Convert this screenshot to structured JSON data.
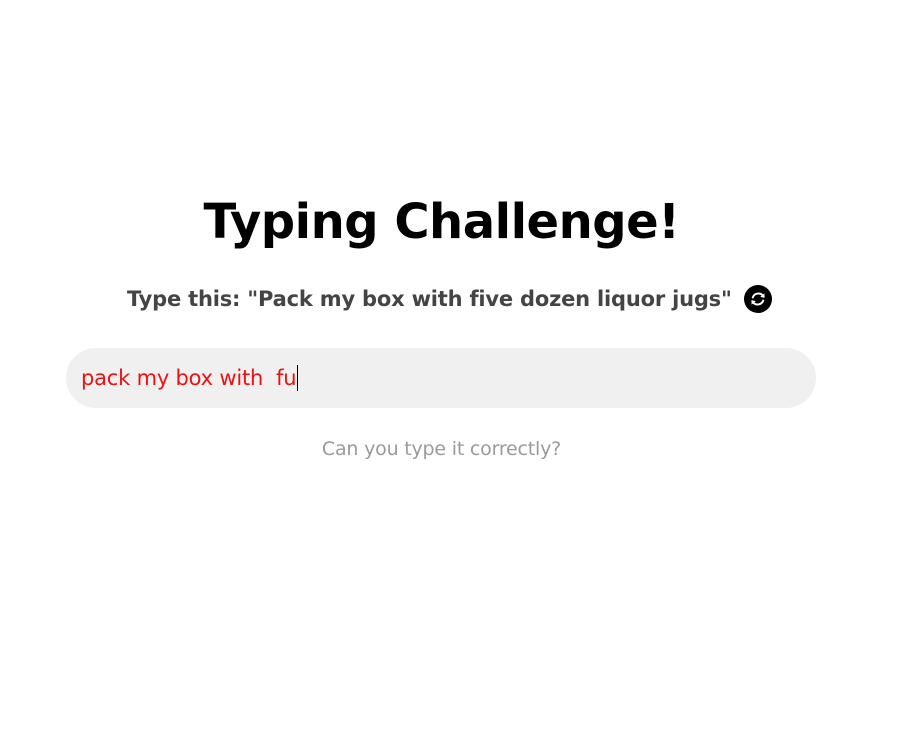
{
  "header": {
    "title": "Typing Challenge!"
  },
  "challenge": {
    "prompt_label": "Type this: \"Pack my box with five dozen liquor jugs\"",
    "refresh_icon": "refresh-icon"
  },
  "input": {
    "value": "pack my box with  fu",
    "text_color": "#ee1111",
    "background": "#f0f0f0"
  },
  "hint": {
    "text": "Can you type it correctly?"
  }
}
